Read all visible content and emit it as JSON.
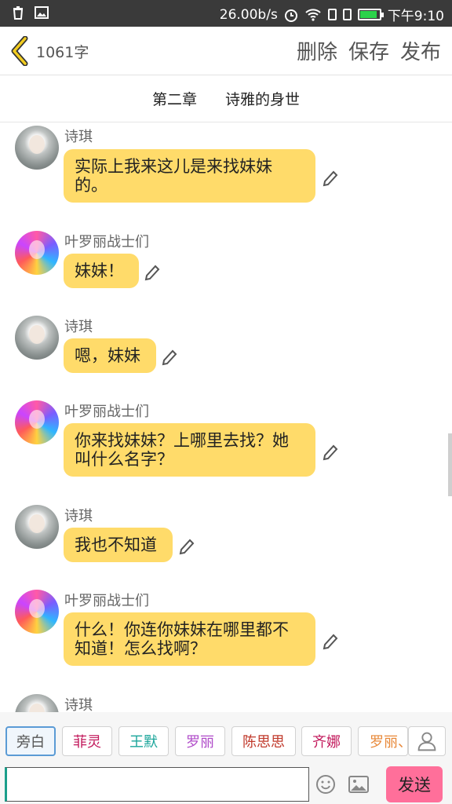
{
  "status_bar": {
    "speed": "26.00b/s",
    "time": "下午9:10",
    "battery_level": 0.9,
    "battery_color": "#2bd34a"
  },
  "header": {
    "word_count": "1061字",
    "actions": {
      "delete": "删除",
      "save": "保存",
      "publish": "发布"
    },
    "accent_color": "#e6b800"
  },
  "chapter": {
    "number": "第二章",
    "title": "诗雅的身世"
  },
  "messages": [
    {
      "speaker": "诗琪",
      "avatar": "shiqi",
      "text": "实际上我来这儿是来找妹妹的。"
    },
    {
      "speaker": "叶罗丽战士们",
      "avatar": "yeluoli",
      "text": "妹妹！"
    },
    {
      "speaker": "诗琪",
      "avatar": "shiqi",
      "text": "嗯，妹妹"
    },
    {
      "speaker": "叶罗丽战士们",
      "avatar": "yeluoli",
      "text": "你来找妹妹？上哪里去找？她叫什么名字？"
    },
    {
      "speaker": "诗琪",
      "avatar": "shiqi",
      "text": "我也不知道"
    },
    {
      "speaker": "叶罗丽战士们",
      "avatar": "yeluoli",
      "text": "什么！你连你妹妹在哪里都不知道！怎么找啊？"
    },
    {
      "speaker": "诗琪",
      "avatar": "shiqi",
      "text": ""
    }
  ],
  "bubble_color": "#ffdb6a",
  "characters": [
    {
      "label": "旁白",
      "color": "#555555",
      "active": true
    },
    {
      "label": "菲灵",
      "color": "#c2185b"
    },
    {
      "label": "王默",
      "color": "#1aa59a"
    },
    {
      "label": "罗丽",
      "color": "#b04cc9"
    },
    {
      "label": "陈思思",
      "color": "#c0392b"
    },
    {
      "label": "齐娜",
      "color": "#c2185b"
    },
    {
      "label": "罗丽、",
      "color": "#e8893a"
    }
  ],
  "input": {
    "value": "",
    "placeholder": ""
  },
  "send_label": "发送",
  "send_color": "#ff6f9a"
}
